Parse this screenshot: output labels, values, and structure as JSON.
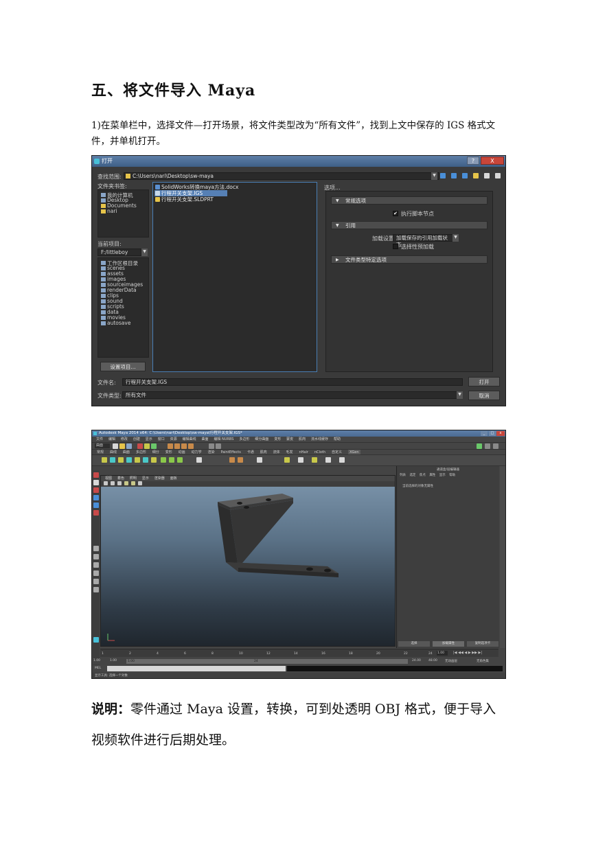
{
  "heading": "五、将文件导入 Maya",
  "step1_paragraph": "1)在菜单栏中，选择文件—打开场景，将文件类型改为“所有文件”，找到上文中保存的 IGS 格式文件，并单机打开。",
  "open_dialog": {
    "title": "打开",
    "help_label": "?",
    "close_label": "X",
    "look_in_label": "查找范围:",
    "path": "C:\\Users\\nari\\Desktop\\sw-maya",
    "bookmarks_label": "文件夹书签:",
    "bookmarks": [
      "我的计算机",
      "Desktop",
      "Documents",
      "nari"
    ],
    "current_project_label": "当前项目:",
    "current_project": "F:/littleboy",
    "project_folders": [
      "工作区根目录",
      "scenes",
      "assets",
      "images",
      "sourceimages",
      "renderData",
      "clips",
      "sound",
      "scripts",
      "data",
      "movies",
      "autosave"
    ],
    "set_project_button": "设置项目...",
    "files": [
      {
        "name": "SolidWorks转换maya方法.docx",
        "selected": false
      },
      {
        "name": "行程开关支架.IGS",
        "selected": true
      },
      {
        "name": "行程开关支架.SLDPRT",
        "selected": false
      }
    ],
    "options_label": "选项...",
    "general_options": "常规选项",
    "execute_script_nodes": "执行脚本节点",
    "references": "引用",
    "load_settings_label": "加载设置",
    "load_settings_value": "加载保存的引用加载状态",
    "selective_preload": "选择性预加载",
    "file_type_specific": "文件类型特定选项",
    "file_name_label": "文件名:",
    "file_name": "行程开关支架.IGS",
    "file_type_label": "文件类型:",
    "file_type": "所有文件",
    "open_button": "打开",
    "cancel_button": "取消"
  },
  "maya_window": {
    "title": "Autodesk Maya 2014 x64: C:\\Users\\nari\\Desktop\\sw-maya\\行程开关支架.IGS*",
    "menus": [
      "文件",
      "编辑",
      "修改",
      "创建",
      "显示",
      "窗口",
      "资源",
      "编辑曲线",
      "曲面",
      "编辑 NURBS",
      "多边形",
      "细分曲面",
      "变形",
      "蒙皮",
      "肌肉",
      "流水线缓存",
      "帮助"
    ],
    "mode": "曲面",
    "shelf_tabs": [
      "常规",
      "曲线",
      "曲面",
      "多边形",
      "细分",
      "变形",
      "动画",
      "动力学",
      "渲染",
      "PaintEffects",
      "卡通",
      "肌肉",
      "流体",
      "毛发",
      "nHair",
      "nCloth",
      "自定义",
      "XGen"
    ],
    "active_shelf_tab": "XGen",
    "viewport_menus": [
      "视图",
      "着色",
      "照明",
      "显示",
      "渲染器",
      "面板"
    ],
    "side_panel_title": "通道盒/层编辑器",
    "side_panel_tabs": [
      "列表",
      "选定",
      "焦点",
      "属性",
      "显示",
      "帮助"
    ],
    "side_panel_message": "当前选择的对象无属性",
    "side_panel_buttons": [
      "选择",
      "加载属性",
      "复制选项卡"
    ],
    "timeline_ticks": [
      "1",
      "2",
      "4",
      "6",
      "8",
      "10",
      "12",
      "14",
      "16",
      "18",
      "20",
      "22",
      "24"
    ],
    "current_frame": "1.00",
    "range_start": "1.00",
    "range_inner_start": "1.00",
    "range_inner_end": "24",
    "range_end_a": "24.00",
    "range_end_b": "48.00",
    "anim_layer": "无动画层",
    "char_set": "无角色集",
    "cmd_label": "MEL",
    "help_line": "显示工具: 选择一个对象"
  },
  "note": {
    "label": "说明：",
    "text": "零件通过 Maya 设置，转换，可到处透明 OBJ 格式，便于导入视频软件进行后期处理。"
  }
}
